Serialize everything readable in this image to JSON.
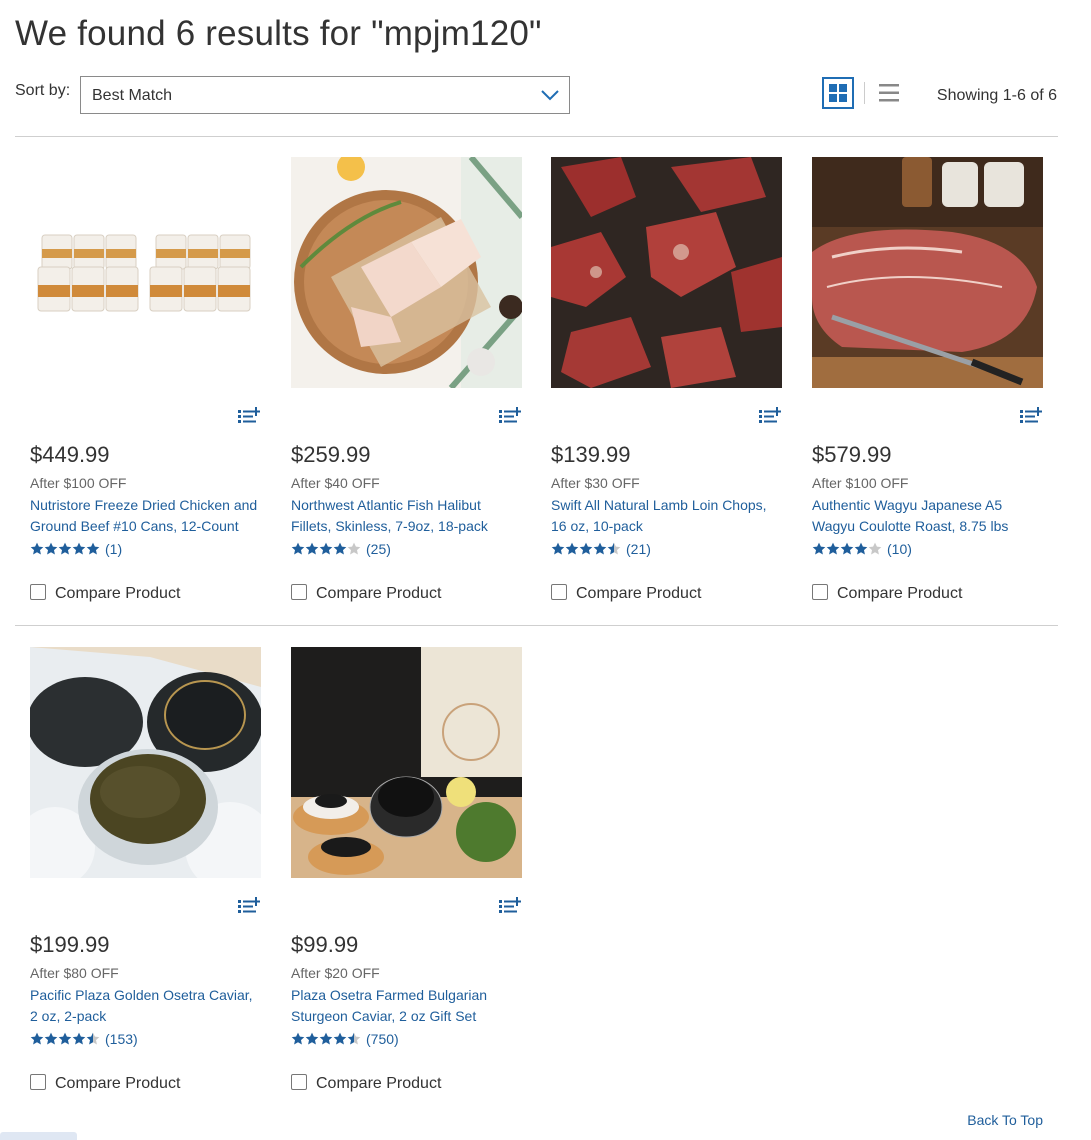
{
  "header": {
    "title": "We found 6 results for \"mpjm120\"",
    "sort_label": "Sort by:",
    "sort_value": "Best Match",
    "showing": "Showing 1-6 of 6"
  },
  "colors": {
    "link": "#1f5e9b",
    "accent": "#1f6db4",
    "star": "#1f5e9b",
    "star_empty": "#c8c8c8"
  },
  "products": [
    {
      "price": "$449.99",
      "discount": "After $100 OFF",
      "name": "Nutristore Freeze Dried Chicken and Ground Beef #10 Cans, 12-Count",
      "rating": 5,
      "reviews": "(1)",
      "compare": "Compare Product",
      "image_icon": "freeze-dried-cans"
    },
    {
      "price": "$259.99",
      "discount": "After $40 OFF",
      "name": "Northwest Atlantic Fish Halibut Fillets, Skinless, 7-9oz, 18-pack",
      "rating": 4,
      "reviews": "(25)",
      "compare": "Compare Product",
      "image_icon": "halibut-fillets"
    },
    {
      "price": "$139.99",
      "discount": "After $30 OFF",
      "name": "Swift All Natural Lamb Loin Chops, 16 oz, 10-pack",
      "rating": 4.5,
      "reviews": "(21)",
      "compare": "Compare Product",
      "image_icon": "lamb-chops"
    },
    {
      "price": "$579.99",
      "discount": "After $100 OFF",
      "name": "Authentic Wagyu Japanese A5 Wagyu Coulotte Roast, 8.75 lbs",
      "rating": 4,
      "reviews": "(10)",
      "compare": "Compare Product",
      "image_icon": "wagyu-roast"
    },
    {
      "price": "$199.99",
      "discount": "After $80 OFF",
      "name": "Pacific Plaza Golden Osetra Caviar, 2 oz, 2-pack",
      "rating": 4.5,
      "reviews": "(153)",
      "compare": "Compare Product",
      "image_icon": "osetra-caviar-tins"
    },
    {
      "price": "$99.99",
      "discount": "After $20 OFF",
      "name": "Plaza Osetra Farmed Bulgarian Sturgeon Caviar, 2 oz Gift Set",
      "rating": 4.5,
      "reviews": "(750)",
      "compare": "Compare Product",
      "image_icon": "caviar-gift-set"
    }
  ],
  "footer": {
    "back_to_top": "Back To Top"
  }
}
